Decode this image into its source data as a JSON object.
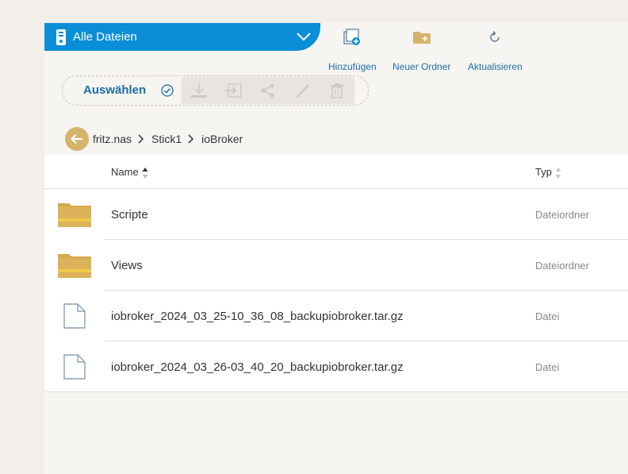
{
  "header": {
    "dropdown_label": "Alle Dateien"
  },
  "toolbar": {
    "add_label": "Hinzufügen",
    "new_folder_label": "Neuer Ordner",
    "refresh_label": "Aktualisieren"
  },
  "selection": {
    "select_label": "Auswählen"
  },
  "breadcrumb": [
    "fritz.nas",
    "Stick1",
    "ioBroker"
  ],
  "table": {
    "col_name": "Name",
    "col_type": "Typ",
    "rows": [
      {
        "name": "Scripte",
        "type": "Dateiordner",
        "icon": "folder-icon"
      },
      {
        "name": "Views",
        "type": "Dateiordner",
        "icon": "folder-icon"
      },
      {
        "name": "iobroker_2024_03_25-10_36_08_backupiobroker.tar.gz",
        "type": "Datei",
        "icon": "file-icon"
      },
      {
        "name": "iobroker_2024_03_26-03_40_20_backupiobroker.tar.gz",
        "type": "Datei",
        "icon": "file-icon"
      }
    ]
  },
  "colors": {
    "accent": "#0a8ed8",
    "link": "#1a6ea8",
    "folder": "#d6b36b"
  }
}
